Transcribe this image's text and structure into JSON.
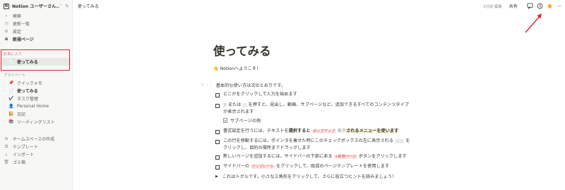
{
  "workspace": {
    "logo": "N",
    "name": "Notion ユーザーさん...",
    "caret_icon": "chevron-down-icon",
    "compose_icon": "compose-icon"
  },
  "sidebar": {
    "top_items": [
      {
        "label": "検索",
        "icon": "search-icon"
      },
      {
        "label": "更新一覧",
        "icon": "clock-icon"
      },
      {
        "label": "設定",
        "icon": "gear-icon"
      },
      {
        "label": "新規ページ",
        "icon": "plus-circle-icon"
      }
    ],
    "favorites_label": "お気に入り",
    "favorites": [
      {
        "label": "使ってみる",
        "icon": "page-icon"
      }
    ],
    "private_label": "プライベート",
    "private_items": [
      {
        "emoji": "📌",
        "label": "クイックメモ"
      },
      {
        "emoji": "📄",
        "label": "使ってみる"
      },
      {
        "emoji": "✔️",
        "label": "タスク管理"
      },
      {
        "emoji": "👤",
        "label": "Personal Home"
      },
      {
        "emoji": "📔",
        "label": "日記"
      },
      {
        "emoji": "📚",
        "label": "リーディングリスト"
      }
    ],
    "bottom_items": [
      {
        "label": "チームスペースの作成",
        "icon": "team-icon"
      },
      {
        "label": "テンプレート",
        "icon": "template-icon"
      },
      {
        "label": "インポート",
        "icon": "import-icon"
      },
      {
        "label": "ゴミ箱",
        "icon": "trash-icon"
      }
    ]
  },
  "topbar": {
    "breadcrumb": "使ってみる",
    "edit_meta": "3分前 編集",
    "share_label": "共有",
    "icons": [
      "comment-icon",
      "clock-icon",
      "star-icon",
      "more-icon"
    ],
    "more_label": "···"
  },
  "page": {
    "title": "使ってみる",
    "welcome": "Notionへようこそ！",
    "welcome_emoji": "👋",
    "intro": "基本的な使い方は次のとおりです。",
    "todo_1": "どこかをクリックして入力を始めます",
    "todo_2_a": "/",
    "todo_2_b": "または",
    "todo_2_c": "を押すと、見出し、動画、サブページなど、追加できるすべてのコンテンツタイプ",
    "todo_2_d": "が表示されます",
    "subpage": "サブページの例",
    "todo_3_a": "書式設定を行うには、テキストを",
    "todo_3_b": "選択すると",
    "todo_3_c": "ポップアップ",
    "todo_3_d": "表示",
    "todo_3_e": "されるメニューを使います",
    "todo_4_a": "この行を移動するには、ポインタを乗せた時にこのチェックボックスの左に表示される",
    "todo_4_b": "⋮⋮",
    "todo_4_c": "を",
    "todo_4_d": "クリックし、目的の場所までドラッグします",
    "todo_5_a": "新しいページを追加するには、サイドバーの下部にある",
    "todo_5_b": "+新規ページ",
    "todo_5_c": "ボタンをクリックします",
    "todo_6_a": "サイドバーの",
    "todo_6_b": "テンプレート",
    "todo_6_c": "をクリックして、既成のページテンプレートを使用します",
    "toggle": "これはトグルです。小さな三角形をクリックして、さらに役立つヒントを読みましょう！"
  }
}
